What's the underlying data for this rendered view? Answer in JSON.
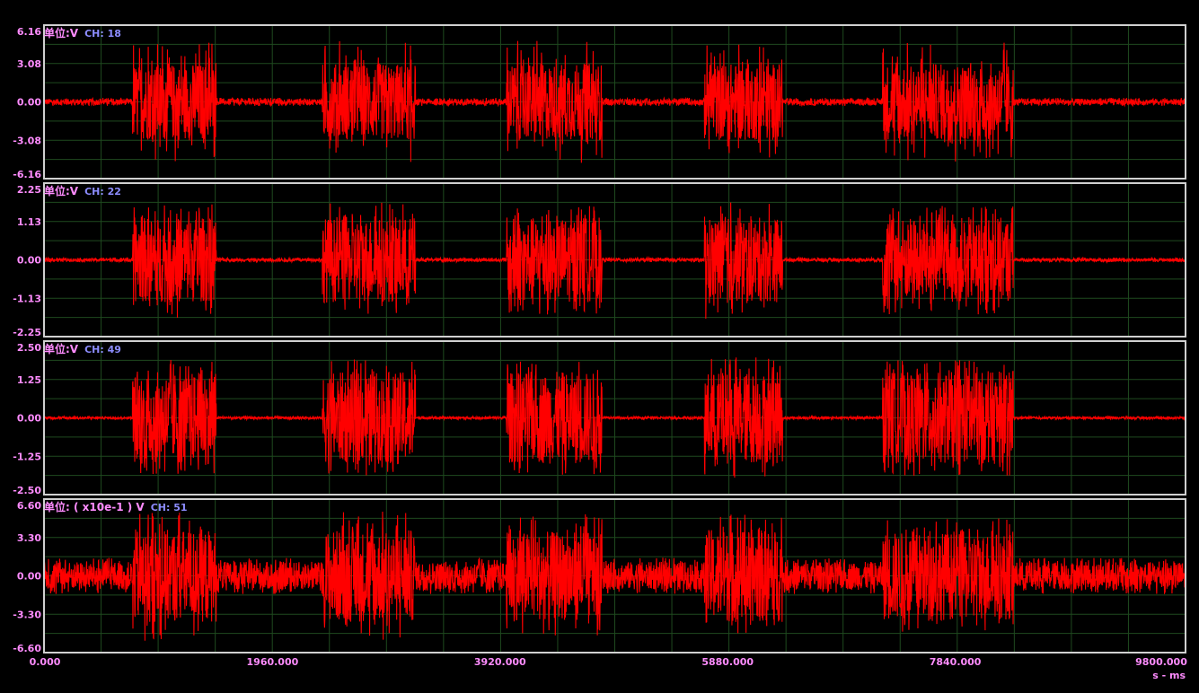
{
  "colors": {
    "background": "#000000",
    "frame": "#d0d0d0",
    "grid": "#1f4a1f",
    "trace": "#ff0000",
    "tick_label": "#ff8cff",
    "channel_label": "#8c8cff"
  },
  "x_axis": {
    "ticks": [
      "0.000",
      "1960.000",
      "3920.000",
      "5880.000",
      "7840.000",
      "9800.000"
    ],
    "unit_label": "s - ms",
    "range": [
      0,
      9800
    ]
  },
  "chart_data": [
    {
      "type": "line",
      "unit_label": "单位:V",
      "channel_label": "CH: 18",
      "y_ticks": [
        "6.16",
        "3.08",
        "0.00",
        "-3.08",
        "-6.16"
      ],
      "ylim": [
        -6.16,
        6.16
      ],
      "x_range": [
        0,
        9800
      ],
      "baseline_amplitude": 0.25,
      "bursts": [
        {
          "start": 760,
          "end": 1480,
          "amplitude": 3.1,
          "peak": 4.8
        },
        {
          "start": 2390,
          "end": 3190,
          "amplitude": 3.1,
          "peak": 4.9
        },
        {
          "start": 3970,
          "end": 4790,
          "amplitude": 3.1,
          "peak": 4.9
        },
        {
          "start": 5670,
          "end": 6340,
          "amplitude": 3.1,
          "peak": 4.6
        },
        {
          "start": 7200,
          "end": 8320,
          "amplitude": 3.1,
          "peak": 4.8
        }
      ]
    },
    {
      "type": "line",
      "unit_label": "单位:V",
      "channel_label": "CH: 22",
      "y_ticks": [
        "2.25",
        "1.13",
        "0.00",
        "-1.13",
        "-2.25"
      ],
      "ylim": [
        -2.25,
        2.25
      ],
      "x_range": [
        0,
        9800
      ],
      "baseline_amplitude": 0.05,
      "bursts": [
        {
          "start": 760,
          "end": 1480,
          "amplitude": 1.25,
          "peak": 1.7
        },
        {
          "start": 2390,
          "end": 3190,
          "amplitude": 1.25,
          "peak": 1.7
        },
        {
          "start": 3970,
          "end": 4790,
          "amplitude": 1.25,
          "peak": 1.6
        },
        {
          "start": 5670,
          "end": 6340,
          "amplitude": 1.25,
          "peak": 1.8
        },
        {
          "start": 7200,
          "end": 8320,
          "amplitude": 1.25,
          "peak": 1.6
        }
      ]
    },
    {
      "type": "line",
      "unit_label": "单位:V",
      "channel_label": "CH: 49",
      "y_ticks": [
        "2.50",
        "1.25",
        "0.00",
        "-1.25",
        "-2.50"
      ],
      "ylim": [
        -2.5,
        2.5
      ],
      "x_range": [
        0,
        9800
      ],
      "baseline_amplitude": 0.04,
      "bursts": [
        {
          "start": 760,
          "end": 1480,
          "amplitude": 1.5,
          "peak": 1.9
        },
        {
          "start": 2390,
          "end": 3190,
          "amplitude": 1.5,
          "peak": 1.9
        },
        {
          "start": 3970,
          "end": 4790,
          "amplitude": 1.5,
          "peak": 1.9
        },
        {
          "start": 5670,
          "end": 6340,
          "amplitude": 1.5,
          "peak": 2.0
        },
        {
          "start": 7200,
          "end": 8320,
          "amplitude": 1.5,
          "peak": 1.9
        }
      ]
    },
    {
      "type": "line",
      "unit_label": "单位: ( x10e-1 ) V",
      "channel_label": "CH: 51",
      "y_ticks": [
        "6.60",
        "3.30",
        "0.00",
        "-3.30",
        "-6.60"
      ],
      "ylim": [
        -6.6,
        6.6
      ],
      "x_range": [
        0,
        9800
      ],
      "baseline_amplitude": 1.2,
      "bursts": [
        {
          "start": 760,
          "end": 1480,
          "amplitude": 4.0,
          "peak": 5.6
        },
        {
          "start": 2390,
          "end": 3190,
          "amplitude": 4.0,
          "peak": 5.6
        },
        {
          "start": 3970,
          "end": 4790,
          "amplitude": 3.8,
          "peak": 5.3
        },
        {
          "start": 5670,
          "end": 6340,
          "amplitude": 4.0,
          "peak": 5.3
        },
        {
          "start": 7200,
          "end": 8320,
          "amplitude": 3.8,
          "peak": 5.0
        }
      ]
    }
  ]
}
